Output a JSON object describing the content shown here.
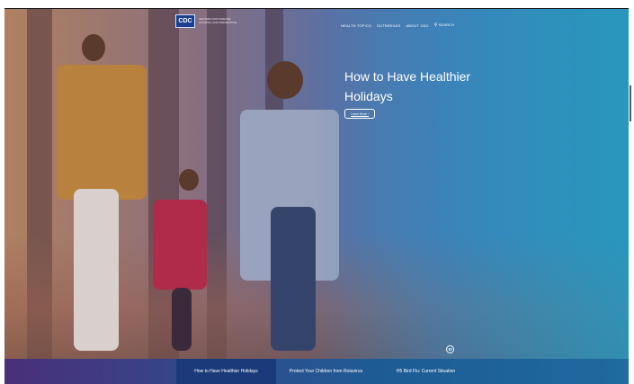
{
  "header": {
    "logo_text": "CDC",
    "logo_tagline_1": "CENTERS FOR DISEASE",
    "logo_tagline_2": "CONTROL AND PREVENTION"
  },
  "nav": {
    "items": [
      "HEALTH TOPICS",
      "OUTBREAKS",
      "ABOUT CDC"
    ],
    "search_label": "SEARCH"
  },
  "hero": {
    "title": "How to Have Healthier Holidays",
    "button_label": "Learn More"
  },
  "carousel": {
    "slides": [
      "How to Have Healthier Holidays",
      "Protect Your Children from Rotavirus",
      "H5 Bird Flu: Current Situation"
    ]
  },
  "colors": {
    "accent": "#1a3f8f",
    "hero_right": "#2a9cbc",
    "carousel_active": "#1a3a7a"
  }
}
